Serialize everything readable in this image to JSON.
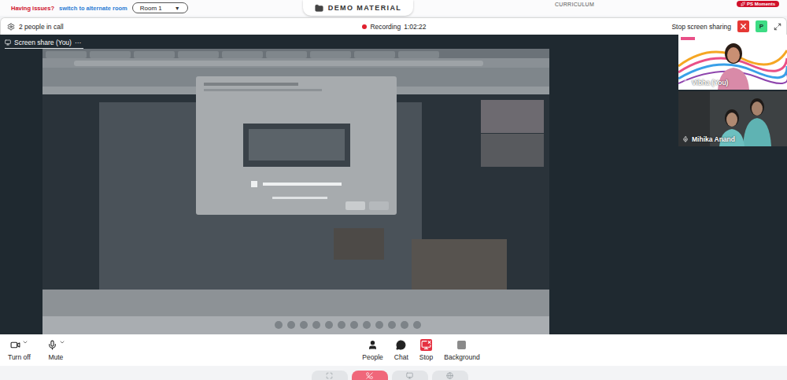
{
  "top_bar": {
    "help_prefix": "Having issues?",
    "help_link": "switch to alternate room",
    "room": {
      "label": "Room 1",
      "caret": "▼"
    },
    "tabs": [
      {
        "label": "DEMO MATERIAL",
        "selected": true
      },
      {
        "label": "CURRICULUM",
        "selected": false
      }
    ],
    "badge": "PS Moments"
  },
  "call_bar": {
    "people": "2 people in call",
    "recording": {
      "label": "Recording",
      "time": "1:02:22",
      "on": true
    },
    "stop_share": "Stop screen sharing",
    "avatar": "P"
  },
  "screen_share": {
    "tab": "Screen share (You)",
    "menu": "···"
  },
  "participants": [
    {
      "name": "Vibha (You)",
      "muted": false,
      "self": true
    },
    {
      "name": "Mihika Anand",
      "muted": false,
      "self": false
    }
  ],
  "controls": {
    "left": [
      {
        "label": "Turn off",
        "kind": "camera",
        "dropdown": true,
        "active": false
      },
      {
        "label": "Mute",
        "kind": "mic",
        "dropdown": true,
        "active": false
      }
    ],
    "center": [
      {
        "label": "People",
        "kind": "people",
        "dropdown": false,
        "active": false
      },
      {
        "label": "Chat",
        "kind": "chat",
        "dropdown": false,
        "active": false
      },
      {
        "label": "Stop",
        "kind": "share",
        "dropdown": false,
        "active": true
      },
      {
        "label": "Background",
        "kind": "background",
        "dropdown": false,
        "active": false
      }
    ]
  },
  "footer_buttons": [
    {
      "kind": "expand",
      "selected": false
    },
    {
      "kind": "leave",
      "selected": true
    },
    {
      "kind": "screen",
      "selected": false
    },
    {
      "kind": "globe",
      "selected": false
    }
  ]
}
